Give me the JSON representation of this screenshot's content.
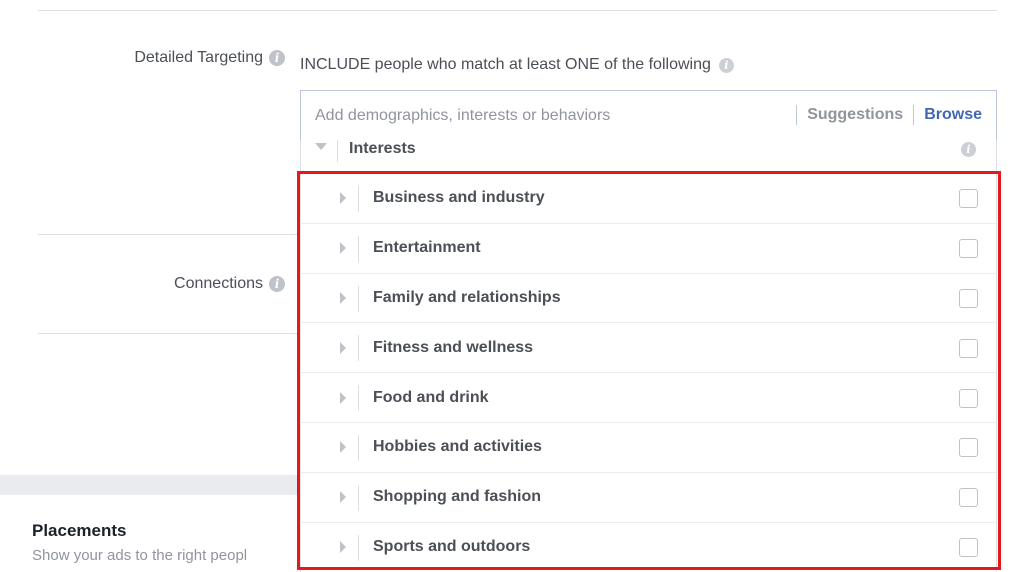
{
  "targeting": {
    "detailed_label": "Detailed Targeting",
    "include_text": "INCLUDE people who match at least ONE of the following",
    "search": {
      "placeholder": "Add demographics, interests or behaviors",
      "suggestions_label": "Suggestions",
      "browse_label": "Browse"
    },
    "dropdown": {
      "header": "Interests",
      "categories": [
        {
          "label": "Business and industry",
          "checked": false
        },
        {
          "label": "Entertainment",
          "checked": false
        },
        {
          "label": "Family and relationships",
          "checked": false
        },
        {
          "label": "Fitness and wellness",
          "checked": false
        },
        {
          "label": "Food and drink",
          "checked": false
        },
        {
          "label": "Hobbies and activities",
          "checked": false
        },
        {
          "label": "Shopping and fashion",
          "checked": false
        },
        {
          "label": "Sports and outdoors",
          "checked": false
        }
      ]
    }
  },
  "connections": {
    "label": "Connections"
  },
  "placements": {
    "title": "Placements",
    "subtitle": "Show your ads to the right peopl"
  },
  "colors": {
    "accent": "#4267b2",
    "highlight_border": "#e21a1a",
    "muted_text": "#90949c"
  },
  "icons": {
    "info": "info-icon",
    "expand": "caret-right-icon",
    "collapse": "caret-down-icon"
  }
}
